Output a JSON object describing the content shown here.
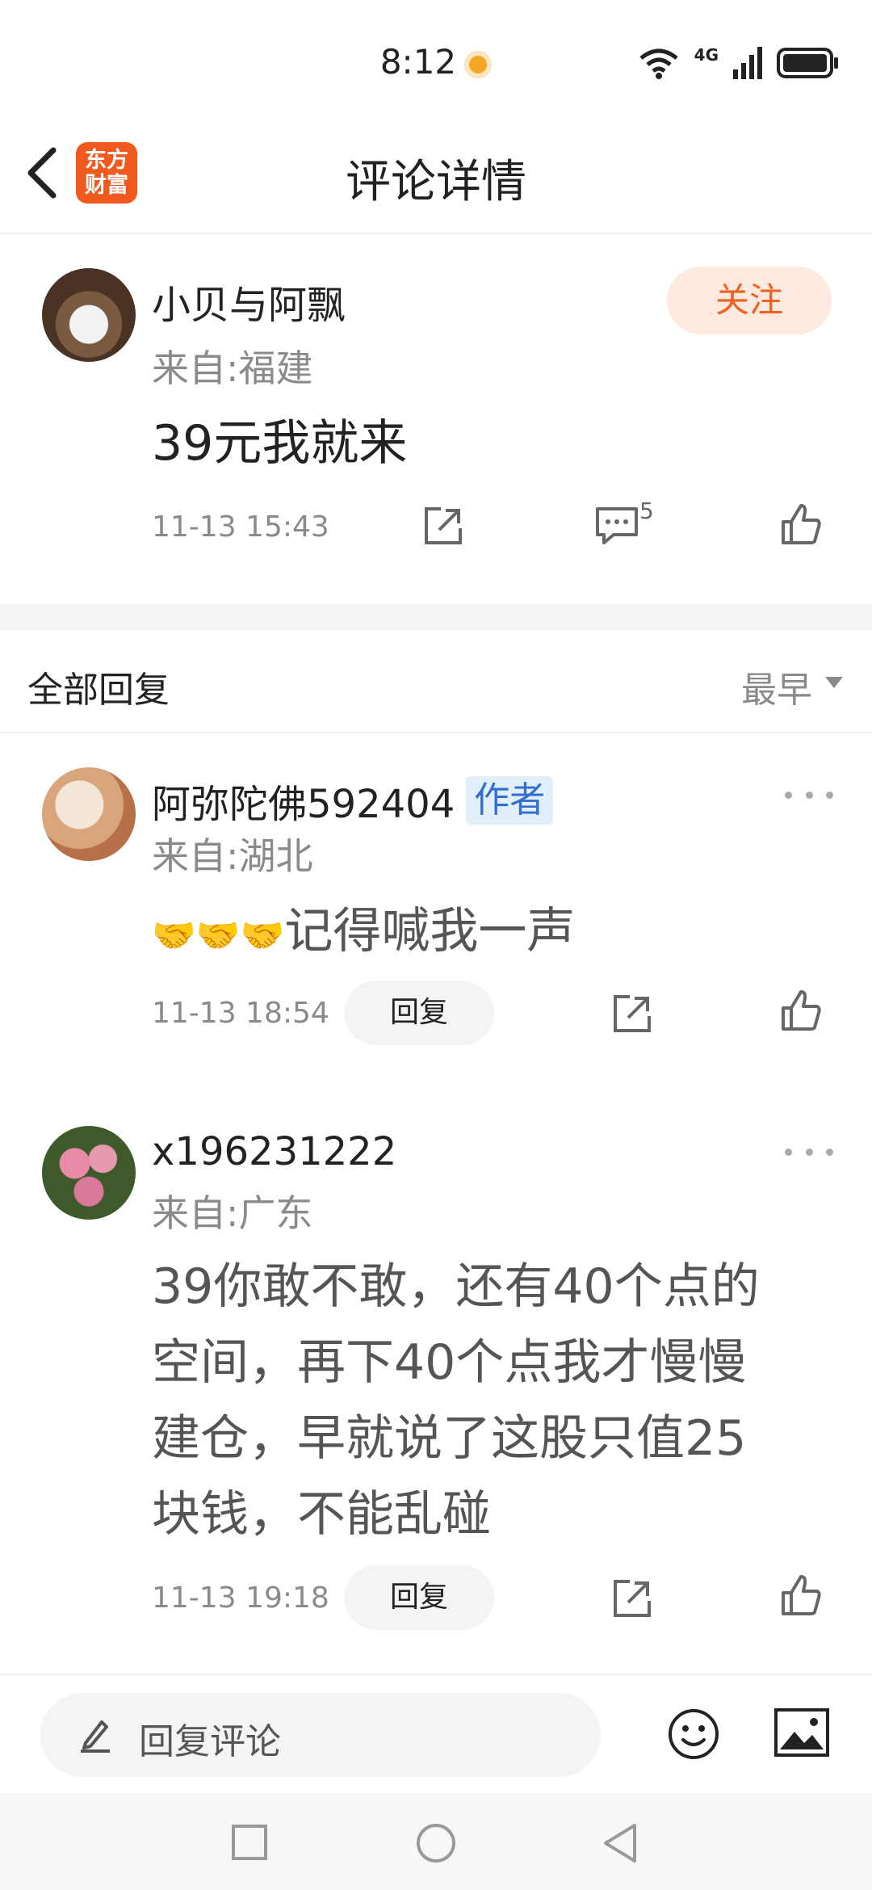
{
  "status": {
    "time": "8:12",
    "network": "4G"
  },
  "header": {
    "title": "评论详情",
    "logo_line1": "东方",
    "logo_line2": "财富"
  },
  "post": {
    "username": "小贝与阿飘",
    "from": "来自:福建",
    "content": "39元我就来",
    "time": "11-13 15:43",
    "comment_count": "5",
    "follow_label": "关注"
  },
  "replies_header": {
    "title": "全部回复",
    "sort": "最早"
  },
  "replies": [
    {
      "username": "阿弥陀佛592404",
      "tag": "作者",
      "from": "来自:湖北",
      "emoji": "🤝🤝🤝",
      "content": "记得喊我一声",
      "time": "11-13 18:54",
      "reply_label": "回复"
    },
    {
      "username": "x196231222",
      "from": "来自:广东",
      "content_lines": [
        "39你敢不敢，还有40个点的",
        "空间，再下40个点我才慢慢",
        "建仓，早就说了这股只值25",
        "块钱，不能乱碰"
      ],
      "time": "11-13 19:18",
      "reply_label": "回复"
    }
  ],
  "bottom": {
    "input_placeholder": "回复评论"
  }
}
